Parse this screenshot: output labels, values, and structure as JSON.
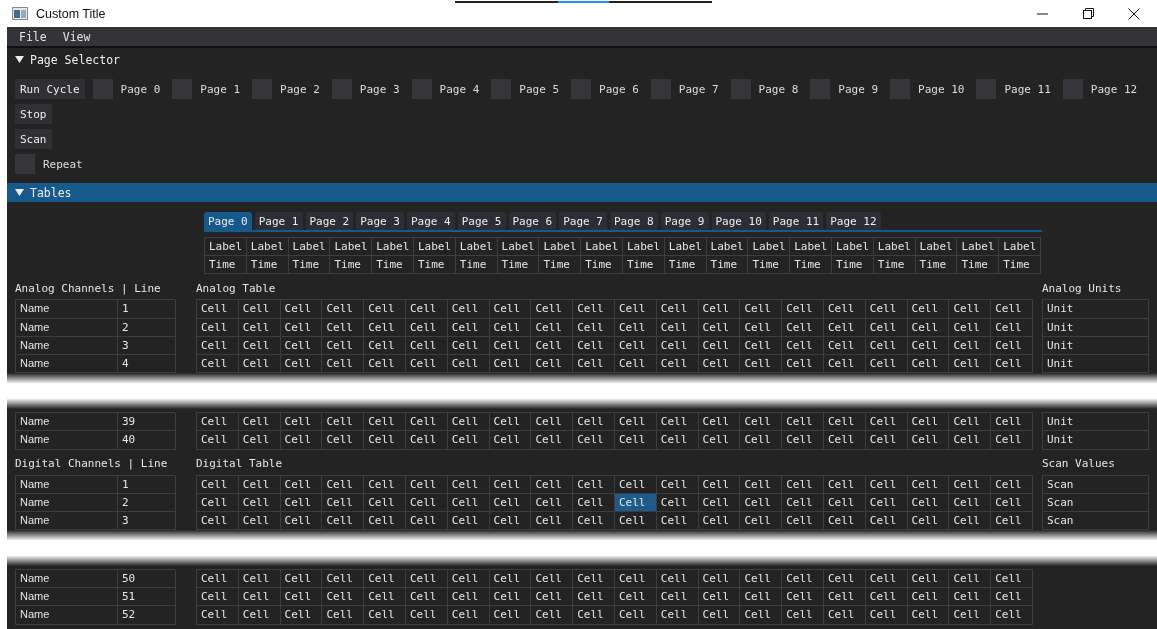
{
  "window": {
    "title": "Custom Title"
  },
  "menu": [
    "File",
    "View"
  ],
  "page_selector": {
    "title": "Page Selector",
    "expanded": true,
    "run_button": "Run Cycle",
    "stop_button": "Stop",
    "scan_button": "Scan",
    "pages": [
      {
        "label": "Page 0",
        "checked": false
      },
      {
        "label": "Page 1",
        "checked": false
      },
      {
        "label": "Page 2",
        "checked": false
      },
      {
        "label": "Page 3",
        "checked": false
      },
      {
        "label": "Page 4",
        "checked": false
      },
      {
        "label": "Page 5",
        "checked": false
      },
      {
        "label": "Page 6",
        "checked": false
      },
      {
        "label": "Page 7",
        "checked": false
      },
      {
        "label": "Page 8",
        "checked": false
      },
      {
        "label": "Page 9",
        "checked": false
      },
      {
        "label": "Page 10",
        "checked": false
      },
      {
        "label": "Page 11",
        "checked": false
      },
      {
        "label": "Page 12",
        "checked": false
      }
    ],
    "repeat": {
      "label": "Repeat",
      "checked": false
    }
  },
  "tables": {
    "title": "Tables",
    "expanded": true,
    "tabs": [
      {
        "label": "Page 0",
        "selected": true
      },
      {
        "label": "Page 1",
        "selected": false
      },
      {
        "label": "Page 2",
        "selected": false
      },
      {
        "label": "Page 3",
        "selected": false
      },
      {
        "label": "Page 4",
        "selected": false
      },
      {
        "label": "Page 5",
        "selected": false
      },
      {
        "label": "Page 6",
        "selected": false
      },
      {
        "label": "Page 7",
        "selected": false
      },
      {
        "label": "Page 8",
        "selected": false
      },
      {
        "label": "Page 9",
        "selected": false
      },
      {
        "label": "Page 10",
        "selected": false
      },
      {
        "label": "Page 11",
        "selected": false
      },
      {
        "label": "Page 12",
        "selected": false
      }
    ],
    "header_rows": [
      [
        "Label",
        "Label",
        "Label",
        "Label",
        "Label",
        "Label",
        "Label",
        "Label",
        "Label",
        "Label",
        "Label",
        "Label",
        "Label",
        "Label",
        "Label",
        "Label",
        "Label",
        "Label",
        "Label",
        "Label"
      ],
      [
        "Time",
        "Time",
        "Time",
        "Time",
        "Time",
        "Time",
        "Time",
        "Time",
        "Time",
        "Time",
        "Time",
        "Time",
        "Time",
        "Time",
        "Time",
        "Time",
        "Time",
        "Time",
        "Time",
        "Time"
      ]
    ],
    "sections": [
      {
        "channels_title": "Analog Channels | Line",
        "table_title": "Analog Table",
        "units_title": "Analog Units",
        "rows_top": [
          {
            "name": "Name",
            "line": "1",
            "unit": "Unit",
            "cells": [
              {
                "text": "Cell",
                "selected": false
              },
              {
                "text": "Cell",
                "selected": false
              },
              {
                "text": "Cell",
                "selected": false
              },
              {
                "text": "Cell",
                "selected": false
              },
              {
                "text": "Cell",
                "selected": false
              },
              {
                "text": "Cell",
                "selected": false
              },
              {
                "text": "Cell",
                "selected": false
              },
              {
                "text": "Cell",
                "selected": false
              },
              {
                "text": "Cell",
                "selected": false
              },
              {
                "text": "Cell",
                "selected": false
              },
              {
                "text": "Cell",
                "selected": false
              },
              {
                "text": "Cell",
                "selected": false
              },
              {
                "text": "Cell",
                "selected": false
              },
              {
                "text": "Cell",
                "selected": false
              },
              {
                "text": "Cell",
                "selected": false
              },
              {
                "text": "Cell",
                "selected": false
              },
              {
                "text": "Cell",
                "selected": false
              },
              {
                "text": "Cell",
                "selected": false
              },
              {
                "text": "Cell",
                "selected": false
              },
              {
                "text": "Cell",
                "selected": false
              }
            ]
          },
          {
            "name": "Name",
            "line": "2",
            "unit": "Unit",
            "cells": [
              {
                "text": "Cell",
                "selected": false
              },
              {
                "text": "Cell",
                "selected": false
              },
              {
                "text": "Cell",
                "selected": false
              },
              {
                "text": "Cell",
                "selected": false
              },
              {
                "text": "Cell",
                "selected": false
              },
              {
                "text": "Cell",
                "selected": false
              },
              {
                "text": "Cell",
                "selected": false
              },
              {
                "text": "Cell",
                "selected": false
              },
              {
                "text": "Cell",
                "selected": false
              },
              {
                "text": "Cell",
                "selected": false
              },
              {
                "text": "Cell",
                "selected": false
              },
              {
                "text": "Cell",
                "selected": false
              },
              {
                "text": "Cell",
                "selected": false
              },
              {
                "text": "Cell",
                "selected": false
              },
              {
                "text": "Cell",
                "selected": false
              },
              {
                "text": "Cell",
                "selected": false
              },
              {
                "text": "Cell",
                "selected": false
              },
              {
                "text": "Cell",
                "selected": false
              },
              {
                "text": "Cell",
                "selected": false
              },
              {
                "text": "Cell",
                "selected": false
              }
            ]
          },
          {
            "name": "Name",
            "line": "3",
            "unit": "Unit",
            "cells": [
              {
                "text": "Cell",
                "selected": false
              },
              {
                "text": "Cell",
                "selected": false
              },
              {
                "text": "Cell",
                "selected": false
              },
              {
                "text": "Cell",
                "selected": false
              },
              {
                "text": "Cell",
                "selected": false
              },
              {
                "text": "Cell",
                "selected": false
              },
              {
                "text": "Cell",
                "selected": false
              },
              {
                "text": "Cell",
                "selected": false
              },
              {
                "text": "Cell",
                "selected": false
              },
              {
                "text": "Cell",
                "selected": false
              },
              {
                "text": "Cell",
                "selected": false
              },
              {
                "text": "Cell",
                "selected": false
              },
              {
                "text": "Cell",
                "selected": false
              },
              {
                "text": "Cell",
                "selected": false
              },
              {
                "text": "Cell",
                "selected": false
              },
              {
                "text": "Cell",
                "selected": false
              },
              {
                "text": "Cell",
                "selected": false
              },
              {
                "text": "Cell",
                "selected": false
              },
              {
                "text": "Cell",
                "selected": false
              },
              {
                "text": "Cell",
                "selected": false
              }
            ]
          },
          {
            "name": "Name",
            "line": "4",
            "unit": "Unit",
            "cells": [
              {
                "text": "Cell",
                "selected": false
              },
              {
                "text": "Cell",
                "selected": false
              },
              {
                "text": "Cell",
                "selected": false
              },
              {
                "text": "Cell",
                "selected": false
              },
              {
                "text": "Cell",
                "selected": false
              },
              {
                "text": "Cell",
                "selected": false
              },
              {
                "text": "Cell",
                "selected": false
              },
              {
                "text": "Cell",
                "selected": false
              },
              {
                "text": "Cell",
                "selected": false
              },
              {
                "text": "Cell",
                "selected": false
              },
              {
                "text": "Cell",
                "selected": false
              },
              {
                "text": "Cell",
                "selected": false
              },
              {
                "text": "Cell",
                "selected": false
              },
              {
                "text": "Cell",
                "selected": false
              },
              {
                "text": "Cell",
                "selected": false
              },
              {
                "text": "Cell",
                "selected": false
              },
              {
                "text": "Cell",
                "selected": false
              },
              {
                "text": "Cell",
                "selected": false
              },
              {
                "text": "Cell",
                "selected": false
              },
              {
                "text": "Cell",
                "selected": false
              }
            ]
          }
        ],
        "rows_bottom": [
          {
            "name": "Name",
            "line": "39",
            "unit": "Unit",
            "cells": [
              {
                "text": "Cell",
                "selected": false
              },
              {
                "text": "Cell",
                "selected": false
              },
              {
                "text": "Cell",
                "selected": false
              },
              {
                "text": "Cell",
                "selected": false
              },
              {
                "text": "Cell",
                "selected": false
              },
              {
                "text": "Cell",
                "selected": false
              },
              {
                "text": "Cell",
                "selected": false
              },
              {
                "text": "Cell",
                "selected": false
              },
              {
                "text": "Cell",
                "selected": false
              },
              {
                "text": "Cell",
                "selected": false
              },
              {
                "text": "Cell",
                "selected": false
              },
              {
                "text": "Cell",
                "selected": false
              },
              {
                "text": "Cell",
                "selected": false
              },
              {
                "text": "Cell",
                "selected": false
              },
              {
                "text": "Cell",
                "selected": false
              },
              {
                "text": "Cell",
                "selected": false
              },
              {
                "text": "Cell",
                "selected": false
              },
              {
                "text": "Cell",
                "selected": false
              },
              {
                "text": "Cell",
                "selected": false
              },
              {
                "text": "Cell",
                "selected": false
              }
            ]
          },
          {
            "name": "Name",
            "line": "40",
            "unit": "Unit",
            "cells": [
              {
                "text": "Cell",
                "selected": false
              },
              {
                "text": "Cell",
                "selected": false
              },
              {
                "text": "Cell",
                "selected": false
              },
              {
                "text": "Cell",
                "selected": false
              },
              {
                "text": "Cell",
                "selected": false
              },
              {
                "text": "Cell",
                "selected": false
              },
              {
                "text": "Cell",
                "selected": false
              },
              {
                "text": "Cell",
                "selected": false
              },
              {
                "text": "Cell",
                "selected": false
              },
              {
                "text": "Cell",
                "selected": false
              },
              {
                "text": "Cell",
                "selected": false
              },
              {
                "text": "Cell",
                "selected": false
              },
              {
                "text": "Cell",
                "selected": false
              },
              {
                "text": "Cell",
                "selected": false
              },
              {
                "text": "Cell",
                "selected": false
              },
              {
                "text": "Cell",
                "selected": false
              },
              {
                "text": "Cell",
                "selected": false
              },
              {
                "text": "Cell",
                "selected": false
              },
              {
                "text": "Cell",
                "selected": false
              },
              {
                "text": "Cell",
                "selected": false
              }
            ]
          }
        ]
      },
      {
        "channels_title": "Digital Channels | Line",
        "table_title": "Digital Table",
        "units_title": "Scan Values",
        "rows_top": [
          {
            "name": "Name",
            "line": "1",
            "unit": "Scan",
            "cells": [
              {
                "text": "Cell",
                "selected": false
              },
              {
                "text": "Cell",
                "selected": false
              },
              {
                "text": "Cell",
                "selected": false
              },
              {
                "text": "Cell",
                "selected": false
              },
              {
                "text": "Cell",
                "selected": false
              },
              {
                "text": "Cell",
                "selected": false
              },
              {
                "text": "Cell",
                "selected": false
              },
              {
                "text": "Cell",
                "selected": false
              },
              {
                "text": "Cell",
                "selected": false
              },
              {
                "text": "Cell",
                "selected": false
              },
              {
                "text": "Cell",
                "selected": false
              },
              {
                "text": "Cell",
                "selected": false
              },
              {
                "text": "Cell",
                "selected": false
              },
              {
                "text": "Cell",
                "selected": false
              },
              {
                "text": "Cell",
                "selected": false
              },
              {
                "text": "Cell",
                "selected": false
              },
              {
                "text": "Cell",
                "selected": false
              },
              {
                "text": "Cell",
                "selected": false
              },
              {
                "text": "Cell",
                "selected": false
              },
              {
                "text": "Cell",
                "selected": false
              }
            ]
          },
          {
            "name": "Name",
            "line": "2",
            "unit": "Scan",
            "cells": [
              {
                "text": "Cell",
                "selected": false
              },
              {
                "text": "Cell",
                "selected": false
              },
              {
                "text": "Cell",
                "selected": false
              },
              {
                "text": "Cell",
                "selected": false
              },
              {
                "text": "Cell",
                "selected": false
              },
              {
                "text": "Cell",
                "selected": false
              },
              {
                "text": "Cell",
                "selected": false
              },
              {
                "text": "Cell",
                "selected": false
              },
              {
                "text": "Cell",
                "selected": false
              },
              {
                "text": "Cell",
                "selected": false
              },
              {
                "text": "Cell",
                "selected": true
              },
              {
                "text": "Cell",
                "selected": false
              },
              {
                "text": "Cell",
                "selected": false
              },
              {
                "text": "Cell",
                "selected": false
              },
              {
                "text": "Cell",
                "selected": false
              },
              {
                "text": "Cell",
                "selected": false
              },
              {
                "text": "Cell",
                "selected": false
              },
              {
                "text": "Cell",
                "selected": false
              },
              {
                "text": "Cell",
                "selected": false
              },
              {
                "text": "Cell",
                "selected": false
              }
            ]
          },
          {
            "name": "Name",
            "line": "3",
            "unit": "Scan",
            "cells": [
              {
                "text": "Cell",
                "selected": false
              },
              {
                "text": "Cell",
                "selected": false
              },
              {
                "text": "Cell",
                "selected": false
              },
              {
                "text": "Cell",
                "selected": false
              },
              {
                "text": "Cell",
                "selected": false
              },
              {
                "text": "Cell",
                "selected": false
              },
              {
                "text": "Cell",
                "selected": false
              },
              {
                "text": "Cell",
                "selected": false
              },
              {
                "text": "Cell",
                "selected": false
              },
              {
                "text": "Cell",
                "selected": false
              },
              {
                "text": "Cell",
                "selected": false
              },
              {
                "text": "Cell",
                "selected": false
              },
              {
                "text": "Cell",
                "selected": false
              },
              {
                "text": "Cell",
                "selected": false
              },
              {
                "text": "Cell",
                "selected": false
              },
              {
                "text": "Cell",
                "selected": false
              },
              {
                "text": "Cell",
                "selected": false
              },
              {
                "text": "Cell",
                "selected": false
              },
              {
                "text": "Cell",
                "selected": false
              },
              {
                "text": "Cell",
                "selected": false
              }
            ]
          }
        ],
        "rows_bottom": [
          {
            "name": "Name",
            "line": "50",
            "cells": [
              {
                "text": "Cell",
                "selected": false
              },
              {
                "text": "Cell",
                "selected": false
              },
              {
                "text": "Cell",
                "selected": false
              },
              {
                "text": "Cell",
                "selected": false
              },
              {
                "text": "Cell",
                "selected": false
              },
              {
                "text": "Cell",
                "selected": false
              },
              {
                "text": "Cell",
                "selected": false
              },
              {
                "text": "Cell",
                "selected": false
              },
              {
                "text": "Cell",
                "selected": false
              },
              {
                "text": "Cell",
                "selected": false
              },
              {
                "text": "Cell",
                "selected": false
              },
              {
                "text": "Cell",
                "selected": false
              },
              {
                "text": "Cell",
                "selected": false
              },
              {
                "text": "Cell",
                "selected": false
              },
              {
                "text": "Cell",
                "selected": false
              },
              {
                "text": "Cell",
                "selected": false
              },
              {
                "text": "Cell",
                "selected": false
              },
              {
                "text": "Cell",
                "selected": false
              },
              {
                "text": "Cell",
                "selected": false
              },
              {
                "text": "Cell",
                "selected": false
              }
            ]
          },
          {
            "name": "Name",
            "line": "51",
            "cells": [
              {
                "text": "Cell",
                "selected": false
              },
              {
                "text": "Cell",
                "selected": false
              },
              {
                "text": "Cell",
                "selected": false
              },
              {
                "text": "Cell",
                "selected": false
              },
              {
                "text": "Cell",
                "selected": false
              },
              {
                "text": "Cell",
                "selected": false
              },
              {
                "text": "Cell",
                "selected": false
              },
              {
                "text": "Cell",
                "selected": false
              },
              {
                "text": "Cell",
                "selected": false
              },
              {
                "text": "Cell",
                "selected": false
              },
              {
                "text": "Cell",
                "selected": false
              },
              {
                "text": "Cell",
                "selected": false
              },
              {
                "text": "Cell",
                "selected": false
              },
              {
                "text": "Cell",
                "selected": false
              },
              {
                "text": "Cell",
                "selected": false
              },
              {
                "text": "Cell",
                "selected": false
              },
              {
                "text": "Cell",
                "selected": false
              },
              {
                "text": "Cell",
                "selected": false
              },
              {
                "text": "Cell",
                "selected": false
              },
              {
                "text": "Cell",
                "selected": false
              }
            ]
          },
          {
            "name": "Name",
            "line": "52",
            "cells": [
              {
                "text": "Cell",
                "selected": false
              },
              {
                "text": "Cell",
                "selected": false
              },
              {
                "text": "Cell",
                "selected": false
              },
              {
                "text": "Cell",
                "selected": false
              },
              {
                "text": "Cell",
                "selected": false
              },
              {
                "text": "Cell",
                "selected": false
              },
              {
                "text": "Cell",
                "selected": false
              },
              {
                "text": "Cell",
                "selected": false
              },
              {
                "text": "Cell",
                "selected": false
              },
              {
                "text": "Cell",
                "selected": false
              },
              {
                "text": "Cell",
                "selected": false
              },
              {
                "text": "Cell",
                "selected": false
              },
              {
                "text": "Cell",
                "selected": false
              },
              {
                "text": "Cell",
                "selected": false
              },
              {
                "text": "Cell",
                "selected": false
              },
              {
                "text": "Cell",
                "selected": false
              },
              {
                "text": "Cell",
                "selected": false
              },
              {
                "text": "Cell",
                "selected": false
              },
              {
                "text": "Cell",
                "selected": false
              },
              {
                "text": "Cell",
                "selected": false
              }
            ]
          }
        ]
      }
    ]
  }
}
